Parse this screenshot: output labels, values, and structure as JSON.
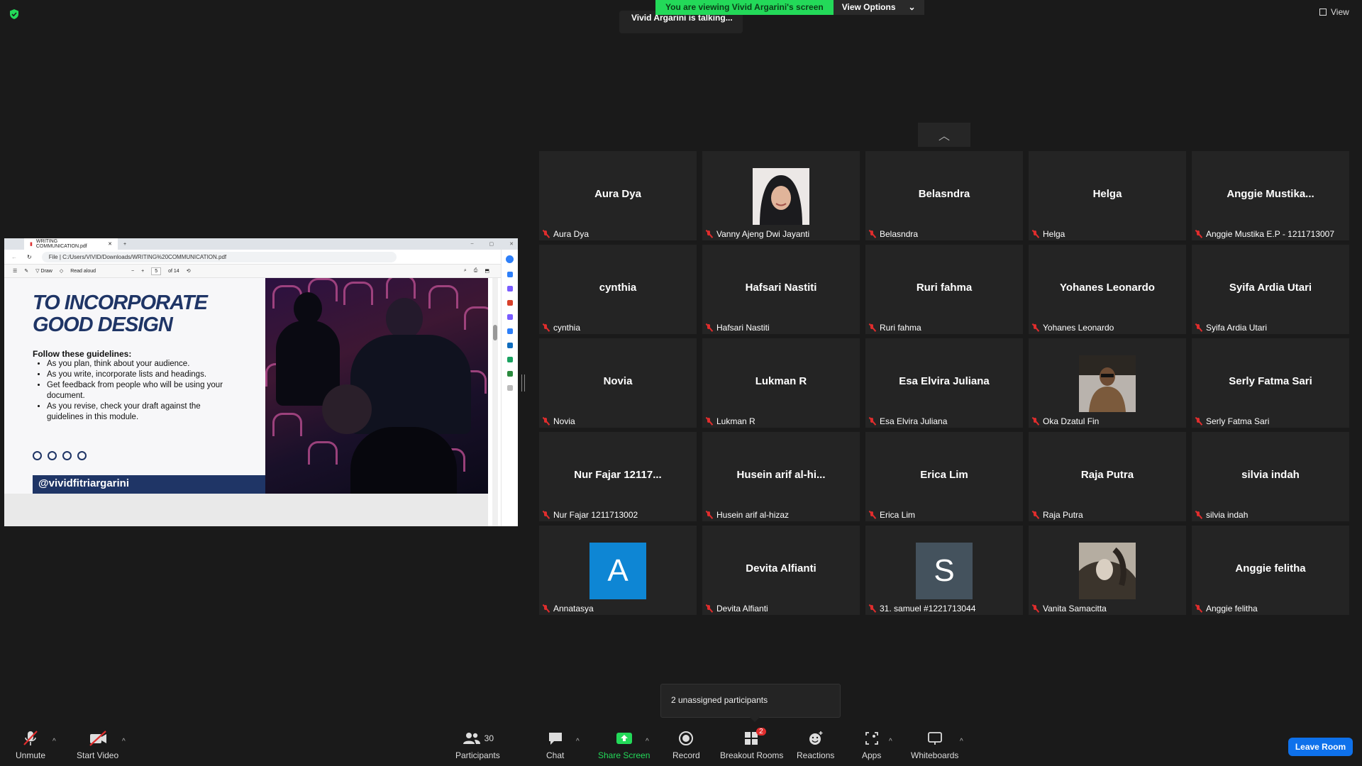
{
  "colors": {
    "bg": "#1a1a1a",
    "tile": "#242424",
    "green": "#23d959",
    "leave": "#0e71eb",
    "muted": "#e02d2d"
  },
  "top": {
    "banner_text": "You are viewing Vivid Argarini's screen",
    "view_options": "View Options",
    "talking": "Vivid Argarini is talking...",
    "view": "View"
  },
  "shared": {
    "tab_title": "WRITING COMMUNICATION.pdf",
    "address_prefix": "File",
    "address": "C:/Users/VIVID/Downloads/WRITING%20COMMUNICATION.pdf",
    "draw": "Draw",
    "read_aloud": "Read aloud",
    "page": "5",
    "page_of": "of 14",
    "slide_title": "TO INCORPORATE\nGOOD DESIGN",
    "guidelines_head": "Follow these guidelines:",
    "guidelines": [
      "As you plan, think about your audience.",
      "As you write, incorporate lists and headings.",
      "Get feedback from people who will be using your document.",
      "As you revise, check your draft against the guidelines in this module."
    ],
    "handle": "@vividfitriargarini"
  },
  "participants": [
    {
      "big": "Aura Dya",
      "name": "Aura Dya"
    },
    {
      "photo": "photo-hijab",
      "name": "Vanny Ajeng Dwi Jayanti"
    },
    {
      "big": "Belasndra",
      "name": "Belasndra"
    },
    {
      "big": "Helga",
      "name": "Helga"
    },
    {
      "big": "Anggie  Mustika...",
      "name": "Anggie Mustika E.P - 1211713007"
    },
    {
      "big": "cynthia",
      "name": "cynthia"
    },
    {
      "big": "Hafsari Nastiti",
      "name": "Hafsari Nastiti"
    },
    {
      "big": "Ruri fahma",
      "name": "Ruri fahma"
    },
    {
      "big": "Yohanes Leonardo",
      "name": "Yohanes Leonardo"
    },
    {
      "big": "Syifa Ardia Utari",
      "name": "Syifa Ardia Utari"
    },
    {
      "big": "Novia",
      "name": "Novia"
    },
    {
      "big": "Lukman R",
      "name": "Lukman R"
    },
    {
      "big": "Esa Elvira Juliana",
      "name": "Esa Elvira Juliana"
    },
    {
      "photo": "photo-man",
      "name": "Oka Dzatul Fin"
    },
    {
      "big": "Serly Fatma Sari",
      "name": "Serly Fatma Sari"
    },
    {
      "big": "Nur Fajar 12117...",
      "name": "Nur Fajar 1211713002"
    },
    {
      "big": "Husein  arif  al-hi...",
      "name": "Husein arif al-hizaz"
    },
    {
      "big": "Erica Lim",
      "name": "Erica Lim"
    },
    {
      "big": "Raja Putra",
      "name": "Raja Putra"
    },
    {
      "big": "silvia indah",
      "name": "silvia indah"
    },
    {
      "avatar": "A",
      "avatar_color": "#0e86d4",
      "name": "Annatasya"
    },
    {
      "big": "Devita Alfianti",
      "name": "Devita Alfianti"
    },
    {
      "avatar": "S",
      "avatar_color": "#44525d",
      "name": "31. samuel #1221713044"
    },
    {
      "photo": "photo-sepia",
      "name": "Vanita Samacitta"
    },
    {
      "big": "Anggie felitha",
      "name": "Anggie felitha"
    }
  ],
  "unassigned": "2 unassigned participants",
  "toolbar": {
    "unmute": "Unmute",
    "start_video": "Start Video",
    "participants": "Participants",
    "participants_count": "30",
    "chat": "Chat",
    "share_screen": "Share Screen",
    "record": "Record",
    "breakout_rooms": "Breakout Rooms",
    "breakout_badge": "2",
    "reactions": "Reactions",
    "apps": "Apps",
    "whiteboards": "Whiteboards",
    "leave": "Leave Room"
  }
}
